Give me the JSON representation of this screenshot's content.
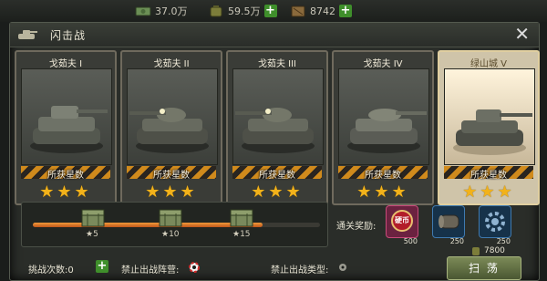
{
  "topbar": {
    "resources": [
      {
        "icon": "cash-icon",
        "value": "37.0万",
        "add_label": ""
      },
      {
        "icon": "supplies-icon",
        "value": "59.5万",
        "add_label": "+"
      },
      {
        "icon": "fuel-icon",
        "value": "8742",
        "add_label": "+"
      }
    ]
  },
  "panel": {
    "title": "闪击战",
    "close_label": "✕"
  },
  "cards": [
    {
      "name": "戈茹夫 I",
      "caption": "所获星数",
      "stars": "★★★",
      "star_count": 3
    },
    {
      "name": "戈茹夫 II",
      "caption": "所获星数",
      "stars": "★★★",
      "star_count": 3
    },
    {
      "name": "戈茹夫 III",
      "caption": "所获星数",
      "stars": "★★★",
      "star_count": 3
    },
    {
      "name": "戈茹夫 IV",
      "caption": "所获星数",
      "stars": "★★★",
      "star_count": 3
    },
    {
      "name": "绿山城 V",
      "caption": "所获星数",
      "stars": "★★★",
      "star_count": 3
    }
  ],
  "progress": {
    "fraction": 0.8,
    "milestones": [
      {
        "label": "★5"
      },
      {
        "label": "★10"
      },
      {
        "label": "★15"
      }
    ]
  },
  "rewards": {
    "label": "通关奖励:",
    "items": [
      {
        "icon": "medal-icon",
        "text": "硬币",
        "qty": "500"
      },
      {
        "icon": "barrel-icon",
        "text": "",
        "qty": "250"
      },
      {
        "icon": "gear-icon",
        "text": "",
        "qty": "250"
      }
    ]
  },
  "bottom": {
    "challenges_label": "挑战次数:0",
    "add_label": "+",
    "ban_formation_label": "禁止出战阵营:",
    "ban_type_label": "禁止出战类型:",
    "cost": "7800",
    "sweep_label": "扫 荡"
  },
  "colors": {
    "accent_orange": "#e8842a",
    "star_gold": "#f2b21a",
    "plus_green": "#3f8f2b"
  }
}
